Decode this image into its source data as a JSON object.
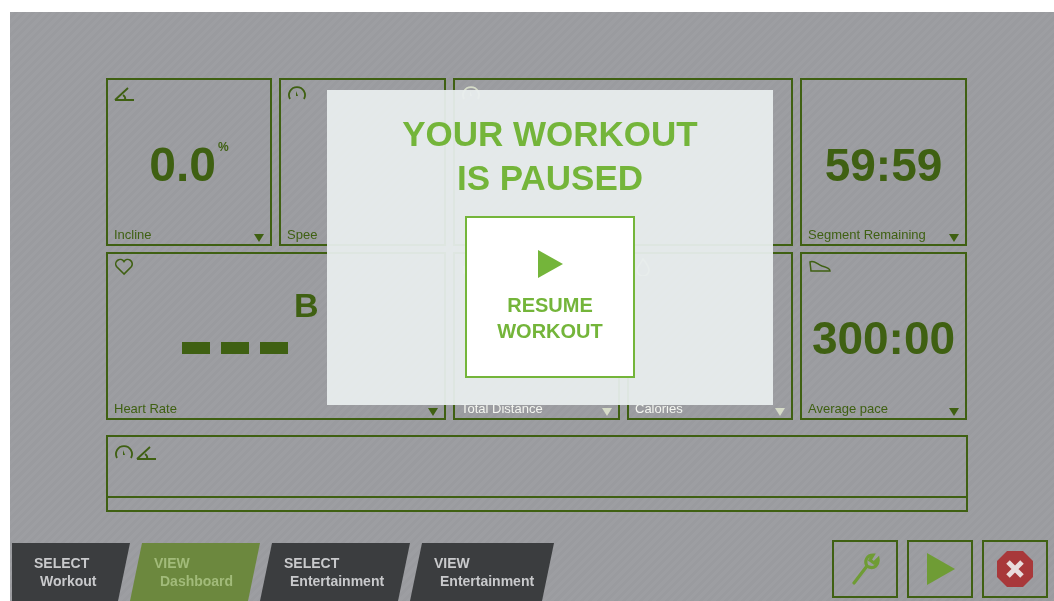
{
  "tiles": [
    {
      "kind": "incline",
      "value": "0.0",
      "unit": "%",
      "label": "Incline"
    },
    {
      "kind": "speed",
      "label": "Spee"
    },
    {
      "kind": "distance"
    },
    {
      "kind": "segment",
      "value": "59:59",
      "label": "Segment Remaining"
    },
    {
      "kind": "heart_rate",
      "unit": "B",
      "label": "Heart Rate"
    },
    {
      "kind": "total_distance",
      "label": "Total Distance"
    },
    {
      "kind": "calories",
      "label": "Calories"
    },
    {
      "kind": "pace",
      "value": "300:00",
      "label": "Average pace"
    }
  ],
  "modal": {
    "title": "YOUR WORKOUT IS PAUSED",
    "button": "RESUME WORKOUT"
  },
  "nav": [
    {
      "action": "SELECT",
      "label": "Workout",
      "selected": false
    },
    {
      "action": "VIEW",
      "label": "Dashboard",
      "selected": true
    },
    {
      "action": "SELECT",
      "label": "Entertainment",
      "selected": false
    },
    {
      "action": "VIEW",
      "label": "Entertainment",
      "selected": false
    }
  ],
  "buttons": [
    {
      "kind": "settings"
    },
    {
      "kind": "play"
    },
    {
      "kind": "stop"
    }
  ]
}
